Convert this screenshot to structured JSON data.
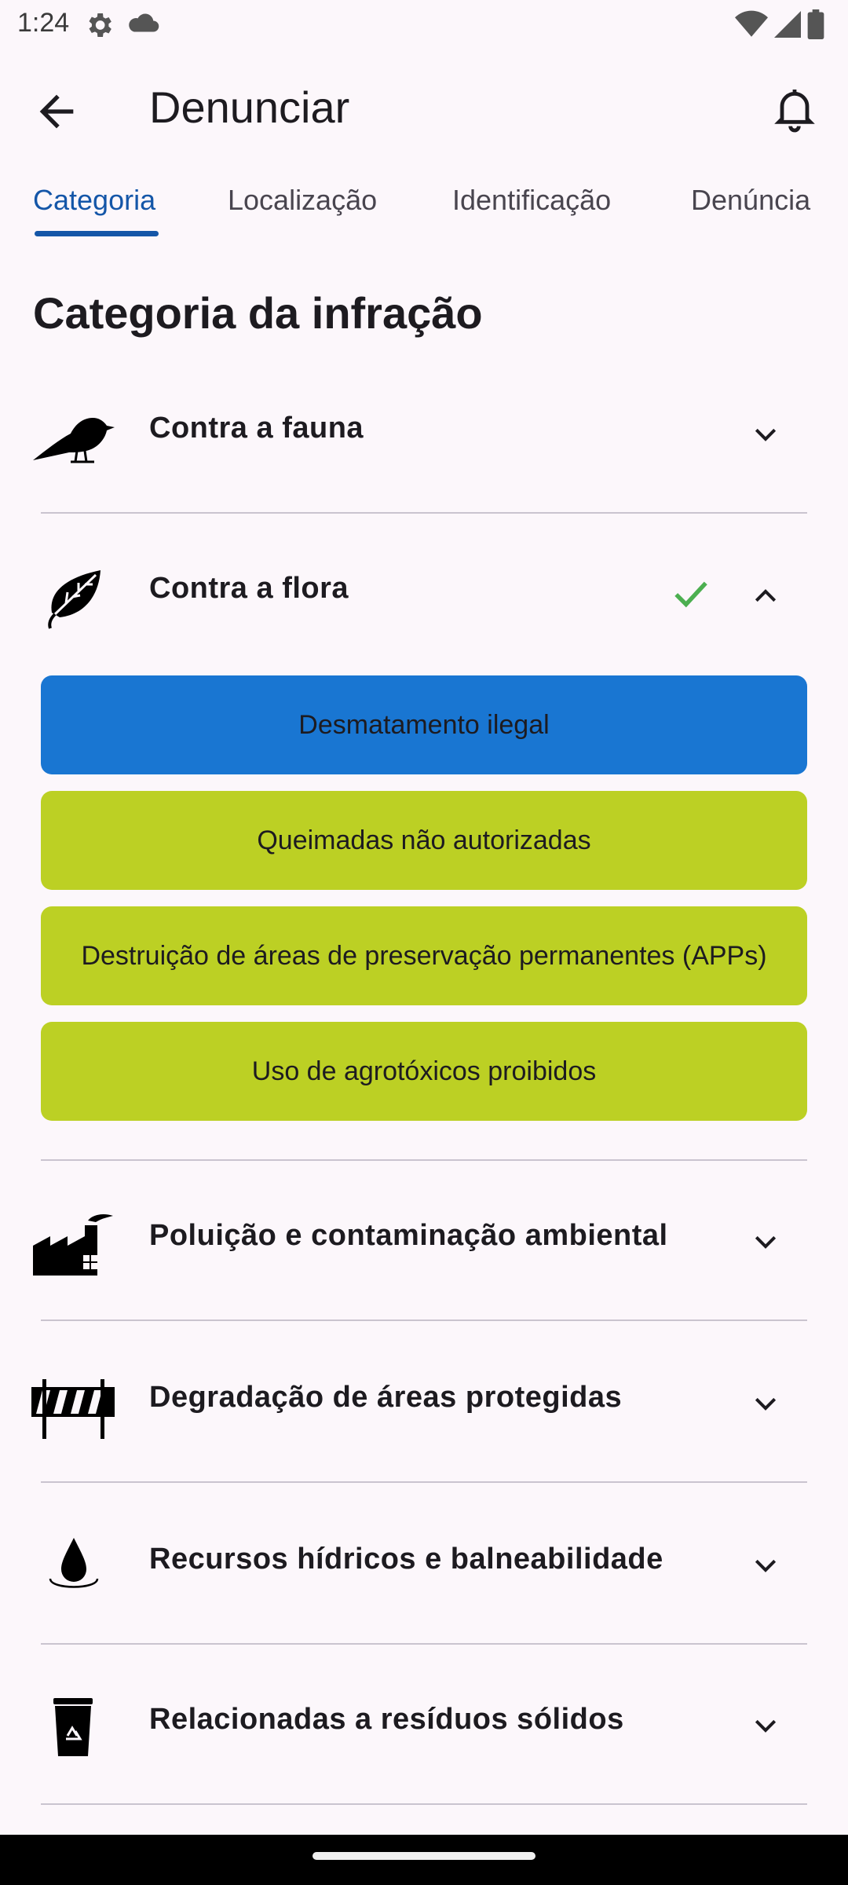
{
  "status_bar": {
    "time": "1:24",
    "icons": [
      "settings-gear-icon",
      "cloud-icon",
      "wifi-icon",
      "cell-signal-icon",
      "battery-icon"
    ]
  },
  "app_bar": {
    "title": "Denunciar",
    "back_icon": "arrow-back-icon",
    "bell_icon": "notifications-bell-icon"
  },
  "tabs": [
    {
      "label": "Categoria",
      "active": true
    },
    {
      "label": "Localização",
      "active": false
    },
    {
      "label": "Identificação",
      "active": false
    },
    {
      "label": "Denúncia",
      "active": false
    }
  ],
  "section_title": "Categoria da infração",
  "categories": [
    {
      "label": "Contra a fauna",
      "icon": "bird-icon",
      "expanded": false,
      "selected": false
    },
    {
      "label": "Contra a flora",
      "icon": "leaf-icon",
      "expanded": true,
      "selected": true,
      "options": [
        {
          "label": "Desmatamento ilegal",
          "selected": true
        },
        {
          "label": "Queimadas não autorizadas",
          "selected": false
        },
        {
          "label": "Destruição de áreas de preservação permanentes (APPs)",
          "selected": false
        },
        {
          "label": "Uso de agrotóxicos proibidos",
          "selected": false
        }
      ]
    },
    {
      "label": "Poluição e contaminação ambiental",
      "icon": "factory-icon",
      "expanded": false,
      "selected": false
    },
    {
      "label": "Degradação de áreas protegidas",
      "icon": "barrier-icon",
      "expanded": false,
      "selected": false
    },
    {
      "label": "Recursos hídricos e balneabilidade",
      "icon": "water-drop-icon",
      "expanded": false,
      "selected": false
    },
    {
      "label": "Relacionadas a resíduos sólidos",
      "icon": "recycle-bin-icon",
      "expanded": false,
      "selected": false
    }
  ],
  "colors": {
    "background": "#fcf7fb",
    "accent": "#1456a8",
    "selected_option": "#1976d2",
    "option": "#bcd024",
    "check": "#4caf50"
  }
}
